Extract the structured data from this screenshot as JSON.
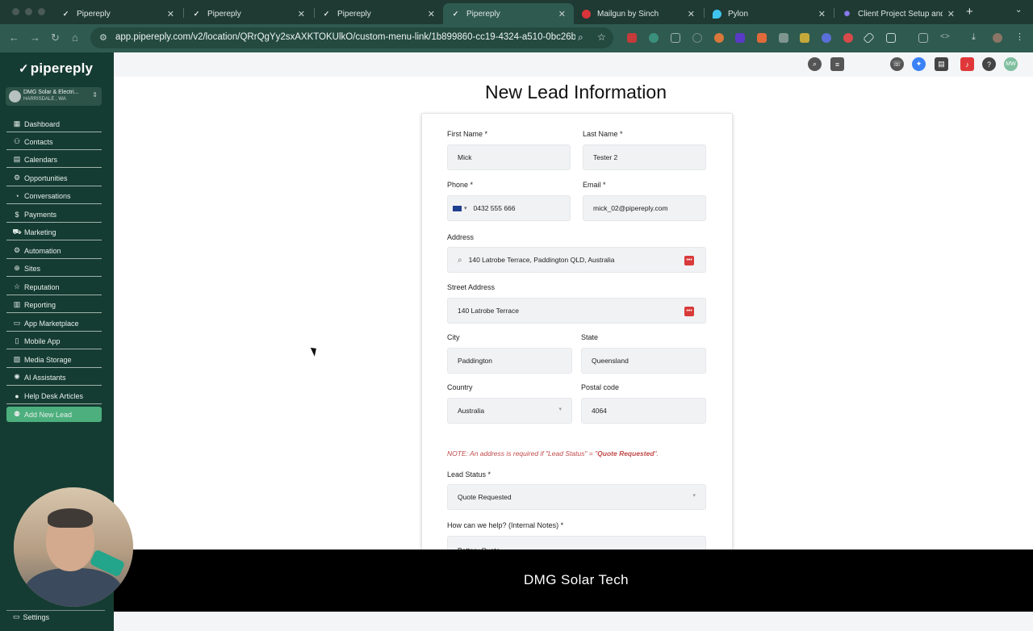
{
  "browser": {
    "tabs": [
      {
        "title": "Pipereply",
        "active": false
      },
      {
        "title": "Pipereply",
        "active": false
      },
      {
        "title": "Pipereply",
        "active": false
      },
      {
        "title": "Pipereply",
        "active": true
      },
      {
        "title": "Mailgun by Sinch",
        "active": false
      },
      {
        "title": "Pylon",
        "active": false
      },
      {
        "title": "Client Project Setup and I",
        "active": false
      }
    ],
    "new_tab": "+",
    "url": "app.pipereply.com/v2/location/QRrQgYy2sxAXKTOKUlkO/custom-menu-link/1b899860-cc19-4324-a510-0bc26b..."
  },
  "sidebar": {
    "logo": "pipereply",
    "account": {
      "name": "DMG Solar & Electri...",
      "location": "HARRISDALE , WA"
    },
    "items": [
      {
        "label": "Dashboard",
        "icon": "dashboard-icon",
        "glyph": "▦"
      },
      {
        "label": "Contacts",
        "icon": "contacts-icon",
        "glyph": "⚇"
      },
      {
        "label": "Calendars",
        "icon": "calendar-icon",
        "glyph": "▤"
      },
      {
        "label": "Opportunities",
        "icon": "opportunities-icon",
        "glyph": "⚙"
      },
      {
        "label": "Conversations",
        "icon": "conversations-icon",
        "glyph": "◔"
      },
      {
        "label": "Payments",
        "icon": "payments-icon",
        "glyph": "$"
      },
      {
        "label": "Marketing",
        "icon": "marketing-icon",
        "glyph": "⛟"
      },
      {
        "label": "Automation",
        "icon": "automation-icon",
        "glyph": "⚙"
      },
      {
        "label": "Sites",
        "icon": "sites-icon",
        "glyph": "⊕"
      },
      {
        "label": "Reputation",
        "icon": "reputation-icon",
        "glyph": "☆"
      },
      {
        "label": "Reporting",
        "icon": "reporting-icon",
        "glyph": "▥"
      },
      {
        "label": "App Marketplace",
        "icon": "marketplace-icon",
        "glyph": "▭"
      },
      {
        "label": "Mobile App",
        "icon": "mobile-icon",
        "glyph": "▯"
      },
      {
        "label": "Media Storage",
        "icon": "media-icon",
        "glyph": "▧"
      },
      {
        "label": "AI Assistants",
        "icon": "ai-icon",
        "glyph": "✺"
      },
      {
        "label": "Help Desk Articles",
        "icon": "help-icon",
        "glyph": "●"
      },
      {
        "label": "Add New Lead",
        "icon": "add-user-icon",
        "glyph": "⚉"
      }
    ],
    "settings": "Settings"
  },
  "form": {
    "title": "New Lead Information",
    "first_name": {
      "label": "First Name *",
      "value": "Mick"
    },
    "last_name": {
      "label": "Last Name *",
      "value": "Tester 2"
    },
    "phone": {
      "label": "Phone *",
      "value": "0432 555 666"
    },
    "email": {
      "label": "Email *",
      "value": "mick_02@pipereply.com"
    },
    "address": {
      "label": "Address",
      "value": "140 Latrobe Terrace, Paddington QLD, Australia"
    },
    "street": {
      "label": "Street Address",
      "value": "140 Latrobe Terrace"
    },
    "city": {
      "label": "City",
      "value": "Paddington"
    },
    "state": {
      "label": "State",
      "value": "Queensland"
    },
    "country": {
      "label": "Country",
      "value": "Australia"
    },
    "postal": {
      "label": "Postal code",
      "value": "4064"
    },
    "note_prefix": "NOTE: An address is required if \"Lead Status\" = \"",
    "note_value": "Quote Requested",
    "note_suffix": "\".",
    "lead_status": {
      "label": "Lead Status *",
      "value": "Quote Requested"
    },
    "help": {
      "label": "How can we help? (Internal Notes) *",
      "value": "Battery Quote"
    }
  },
  "topbar": {
    "avatar_initials": "MW"
  },
  "banner": {
    "text": "DMG Solar Tech"
  },
  "colors": {
    "sidebar": "#153c32",
    "accent": "#4caf7d",
    "note": "#c14a4a",
    "chrome": "#2f5a4f"
  }
}
